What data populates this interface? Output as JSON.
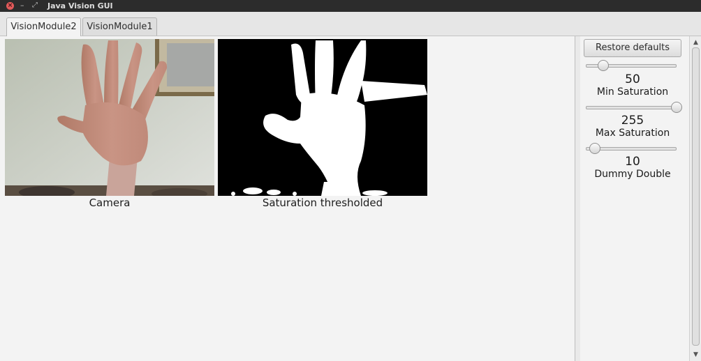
{
  "window": {
    "title": "Java Vision GUI"
  },
  "tabs": [
    {
      "label": "VisionModule2",
      "active": true
    },
    {
      "label": "VisionModule1",
      "active": false
    }
  ],
  "images": {
    "camera_caption": "Camera",
    "threshold_caption": "Saturation thresholded"
  },
  "controls": {
    "restore_label": "Restore defaults",
    "sliders": [
      {
        "name": "Min Saturation",
        "value": "50",
        "fraction": 0.196
      },
      {
        "name": "Max Saturation",
        "value": "255",
        "fraction": 1.0
      },
      {
        "name": "Dummy Double",
        "value": "10",
        "fraction": 0.1
      }
    ]
  },
  "colors": {
    "titlebar": "#2c2c2c",
    "close_button": "#e25a5a",
    "panel_bg": "#f3f3f3"
  }
}
